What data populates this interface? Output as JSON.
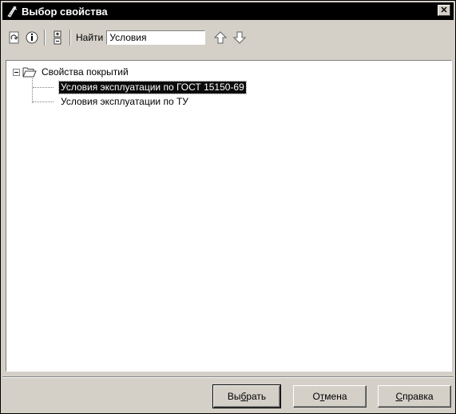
{
  "window": {
    "title": "Выбор свойства",
    "close_symbol": "✕"
  },
  "toolbar": {
    "find_label": "Найти",
    "search_value": "Условия",
    "icons": [
      "refresh-icon",
      "info-icon",
      "expand-collapse-icon",
      "arrow-up-icon",
      "arrow-down-icon"
    ]
  },
  "tree": {
    "root": {
      "label": "Свойства покрытий",
      "expanded": true,
      "icon": "open-folder-icon"
    },
    "children": [
      {
        "label": "Условия эксплуатации по ГОСТ 15150-69",
        "selected": true
      },
      {
        "label": "Условия эксплуатации по ТУ",
        "selected": false
      }
    ]
  },
  "buttons": {
    "select": {
      "pre": "Вы",
      "accel": "б",
      "post": "рать"
    },
    "cancel": {
      "pre": "О",
      "accel": "т",
      "post": "мена"
    },
    "help": {
      "pre": "",
      "accel": "С",
      "post": "правка"
    }
  }
}
